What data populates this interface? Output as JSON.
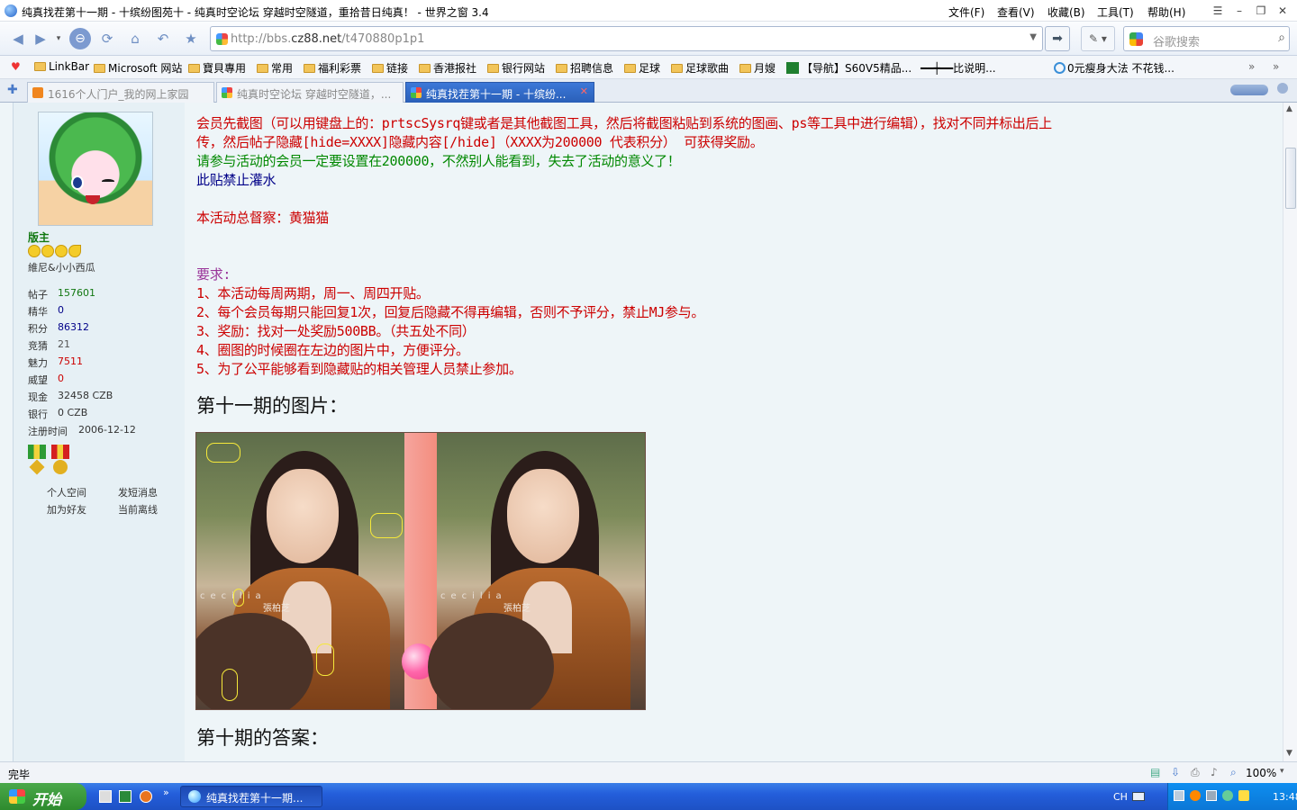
{
  "window": {
    "title": "纯真找茬第十一期 - 十缤纷图苑十 - 纯真时空论坛 穿越时空隧道，重拾昔日纯真！ - 世界之窗 3.4",
    "menu": [
      "文件(F)",
      "查看(V)",
      "收藏(B)",
      "工具(T)",
      "帮助(H)"
    ]
  },
  "address": {
    "prefix": "http://bbs.",
    "domain": "cz88.net",
    "path": "/t470880p1p1"
  },
  "search": {
    "placeholder": "谷歌搜索"
  },
  "favorites": [
    "LinkBar",
    "Microsoft 网站",
    "寶貝專用",
    "常用",
    "福利彩票",
    "链接",
    "香港报社",
    "银行网站",
    "招聘信息",
    "足球",
    "足球歌曲",
    "月嫂",
    "【导航】S60V5精品...",
    "━━┿━━比说明...",
    "0元瘦身大法 不花钱..."
  ],
  "tabs": [
    {
      "label": "1616个人门户_我的网上家园",
      "active": false
    },
    {
      "label": "纯真时空论坛 穿越时空隧道，...",
      "active": false
    },
    {
      "label": "纯真找茬第十一期 - 十缤纷...",
      "active": true
    }
  ],
  "user": {
    "rank": "版主",
    "name": "維尼&小小西瓜",
    "stats": [
      {
        "label": "帖子",
        "value": "157601",
        "color": "#117711"
      },
      {
        "label": "精华",
        "value": "0",
        "color": "#000088"
      },
      {
        "label": "积分",
        "value": "86312",
        "color": "#000088"
      },
      {
        "label": "竞猜",
        "value": "21",
        "color": "#555555"
      },
      {
        "label": "魅力",
        "value": "7511",
        "color": "#cc0000"
      },
      {
        "label": "威望",
        "value": "0",
        "color": "#cc0000"
      },
      {
        "label": "现金",
        "value": "32458 CZB",
        "color": "#333333"
      },
      {
        "label": "银行",
        "value": "0 CZB",
        "color": "#333333"
      },
      {
        "label": "注册时间",
        "value": "2006-12-12",
        "color": "#333333"
      }
    ],
    "links": [
      "个人空间",
      "发短消息",
      "加为好友",
      "当前离线"
    ]
  },
  "post": {
    "line1": "会员先截图（可以用键盘上的：prtscSysrq键或者是其他截图工具，然后将截图粘贴到系统的图画、ps等工具中进行编辑），找对不同并标出后上",
    "line2": "传，然后帖子隐藏[hide=XXXX]隐藏内容[/hide]（XXXX为200000 代表积分） 可获得奖励。",
    "line3": "请参与活动的会员一定要设置在200000，不然别人能看到，失去了活动的意义了！",
    "line4": "此贴禁止灌水",
    "supervisor": "本活动总督察：黄猫猫",
    "req_title": "要求:",
    "requirements": [
      "1、本活动每周两期，周一、周四开贴。",
      "2、每个会员每期只能回复1次，回复后隐藏不得再编辑，否则不予评分，禁止MJ参与。",
      "3、奖励：找对一处奖励500BB。（共五处不同）",
      "4、圈图的时候圈在左边的图片中，方便评分。",
      "5、为了公平能够看到隐藏贴的相关管理人员禁止参加。"
    ],
    "heading1": "第十一期的图片：",
    "heading2": "第十期的答案：",
    "image_text_left": "cecilia",
    "image_text_left2": "張柏芝",
    "image_text_right": "cecilia",
    "image_text_right2": "張柏芝"
  },
  "status": {
    "text": "完毕",
    "zoom": "100%"
  },
  "taskbar": {
    "start": "开始",
    "task": "纯真找茬第十一期...",
    "lang": "CH",
    "time": "13:48"
  }
}
